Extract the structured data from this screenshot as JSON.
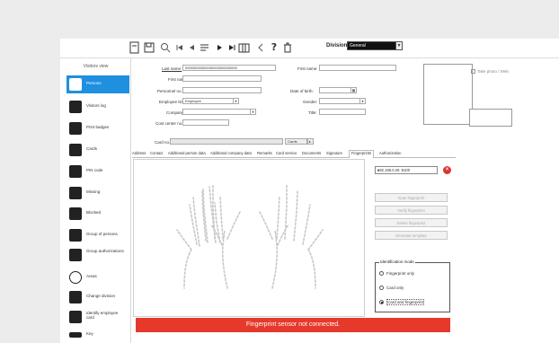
{
  "toolbar": {
    "icons": [
      "new-document-icon",
      "save-icon",
      "search-icon",
      "first-record-icon",
      "previous-record-icon",
      "filter-icon",
      "next-record-icon",
      "last-record-icon",
      "columns-icon",
      "back-icon",
      "help-icon",
      "delete-icon"
    ],
    "help_glyph": "?",
    "division_label": "Division:",
    "division_value": "General"
  },
  "sidebar": {
    "title": "Visitors view",
    "items": [
      {
        "label": "Persons",
        "icon": "person-icon",
        "active": true
      },
      {
        "label": "Visitors log",
        "icon": "visitors-icon"
      },
      {
        "label": "Print badges",
        "icon": "printer-icon"
      },
      {
        "label": "Cards",
        "icon": "card-person-icon"
      },
      {
        "label": "PIN code",
        "icon": "pin-person-icon"
      },
      {
        "label": "Missing",
        "icon": "missing-person-icon"
      },
      {
        "label": "Blocked",
        "icon": "blocked-icon"
      },
      {
        "label": "Group of persons",
        "icon": "group-icon"
      },
      {
        "label": "Group authorizations",
        "icon": "group-authorizations-icon"
      },
      {
        "label": "Areas",
        "icon": "area-target-icon"
      },
      {
        "label": "Change division",
        "icon": "change-division-icon"
      },
      {
        "label": "Identify employee card",
        "icon": "identify-card-icon"
      },
      {
        "label": "Key",
        "icon": "key-icon"
      }
    ]
  },
  "form": {
    "last_name_label": "Last name:",
    "last_name_value": "00000000000000000000000000",
    "first_name_label": "First name:",
    "personnel_label": "Personnel no.:",
    "employee_label": "Employee ID:",
    "employee_value": "Employee",
    "company_label": "Company:",
    "cost_center_label": "Cost center no.:",
    "first_name2_label": "First name:",
    "date_label": "Date of birth:",
    "gender_label": "Gender:",
    "title_label": "Title:",
    "card_label": "Card no.:",
    "card_button": "Cards",
    "photo_checkbox": "Take photo / Web"
  },
  "tabs": [
    "Address",
    "Contact",
    "Additional person data",
    "Additional company data",
    "Remarks",
    "Card service",
    "Documents",
    "Signature",
    "Fingerprints",
    "Authorization"
  ],
  "active_tab": "Fingerprints",
  "fingerprint": {
    "reader_value": "192.168.0.26 :9100",
    "buttons": [
      "Scan fingerprint",
      "Verify fingerprint",
      "Delete fingerprint",
      "Generate template"
    ],
    "id_mode_title": "Identification mode",
    "modes": [
      {
        "label": "Fingerprint only",
        "selected": false
      },
      {
        "label": "Card only",
        "selected": false
      },
      {
        "label": "Card and fingerprint",
        "selected": true
      }
    ],
    "error": "Fingerprint sensor not connected."
  },
  "colors": {
    "accent": "#1f8fe0",
    "error": "#e6392b"
  }
}
